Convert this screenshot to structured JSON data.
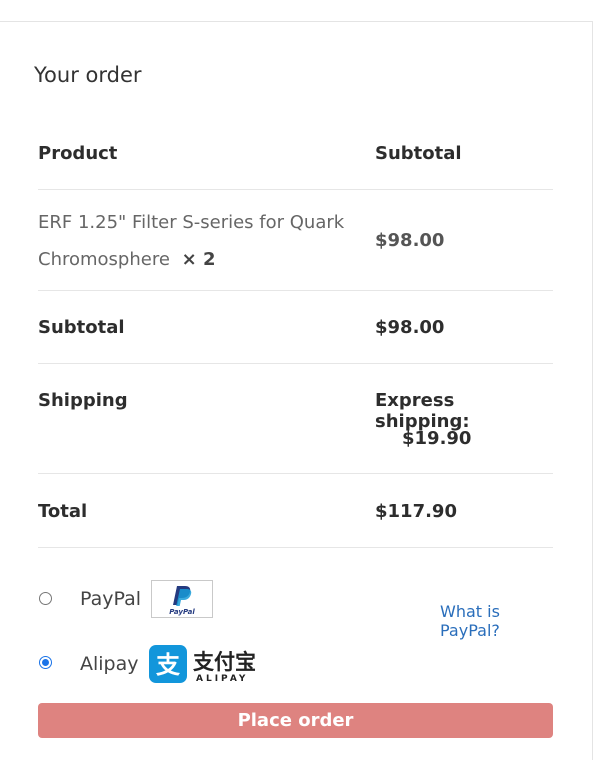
{
  "order": {
    "title": "Your order",
    "headers": {
      "product": "Product",
      "subtotal": "Subtotal"
    },
    "item": {
      "name_line1": "ERF 1.25\" Filter S-series for Quark",
      "name_line2": "Chromosphere",
      "qty": "× 2",
      "price": "$98.00"
    },
    "subtotal": {
      "label": "Subtotal",
      "value": "$98.00"
    },
    "shipping": {
      "label": "Shipping",
      "method": "Express shipping:",
      "value": "$19.90"
    },
    "total": {
      "label": "Total",
      "value": "$117.90"
    }
  },
  "payment": {
    "paypal": {
      "label": "PayPal",
      "logo_text": "PayPal",
      "link": "What is PayPal?",
      "selected": false
    },
    "alipay": {
      "label": "Alipay",
      "logo_cn": "支付宝",
      "logo_en": "ALIPAY",
      "selected": true
    }
  },
  "place_order": {
    "label": "Place order"
  },
  "colors": {
    "accent": "#de8380",
    "link": "#2a6ebb",
    "radio": "#1a73e8",
    "alipay": "#1296db"
  }
}
